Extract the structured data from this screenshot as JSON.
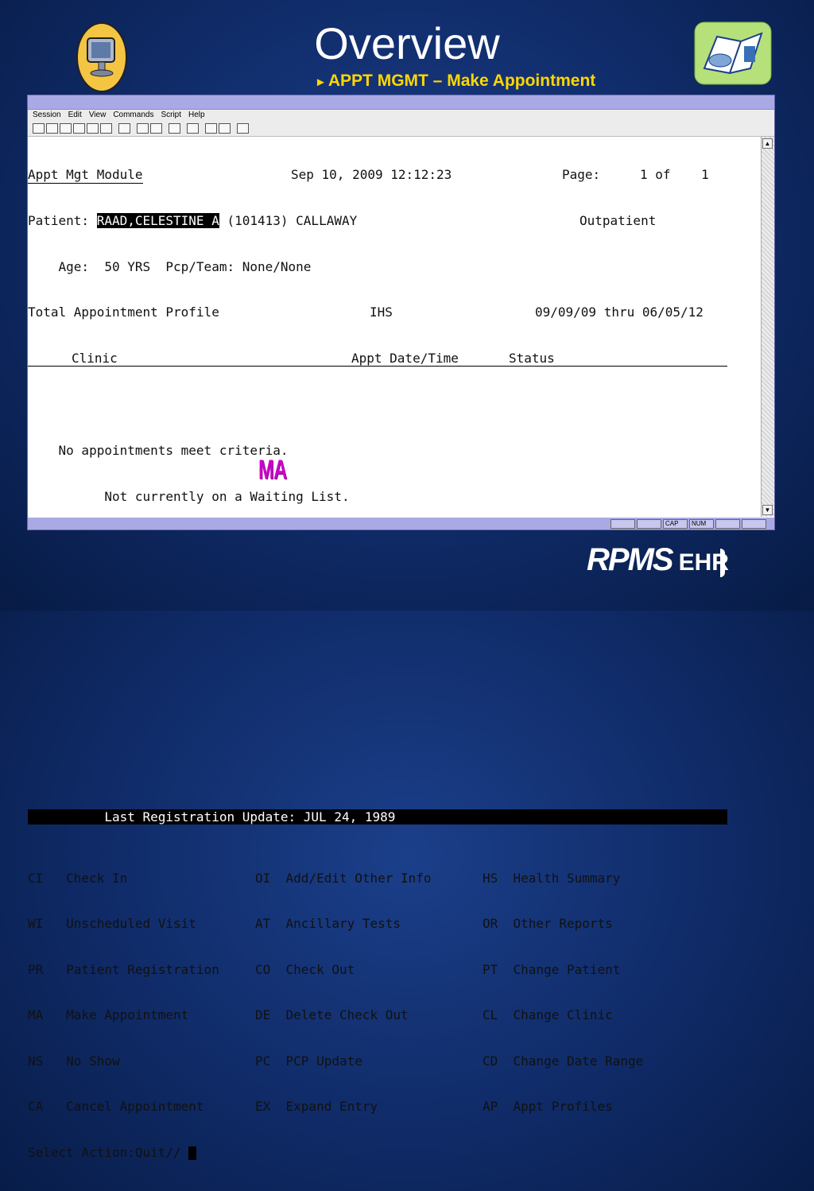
{
  "slide": {
    "title": "Overview",
    "subtitle": "APPT MGMT – Make Appointment",
    "subtitle_arrow": "►",
    "stamp": "MA",
    "logo_main": "RPMS",
    "logo_sub": "EHR",
    "icons": [
      "computer-monitor-icon",
      "open-book-icon"
    ]
  },
  "menu": [
    "Session",
    "Edit",
    "View",
    "Commands",
    "Script",
    "Help"
  ],
  "terminal": {
    "header_left": "Appt Mgt Module",
    "header_date": "Sep 10, 2009 12:12:23",
    "header_page_label": "Page:",
    "header_page": "1 of    1",
    "patient_label": "Patient:",
    "patient_name": "RAAD,CELESTINE A",
    "patient_rest": "(101413) CALLAWAY",
    "patient_type": "Outpatient",
    "age_line": "    Age:  50 YRS  Pcp/Team: None/None",
    "profile_line_left": "Total Appointment Profile",
    "profile_ihs": "IHS",
    "profile_range": "09/09/09 thru 06/05/12",
    "col_clinic": "Clinic",
    "col_appt": "Appt Date/Time",
    "col_status": "Status",
    "msg1": "    No appointments meet criteria.",
    "msg2": "          Not currently on a Waiting List.",
    "last_reg": "          Last Registration Update: JUL 24, 1989",
    "actions": [
      [
        "CI   Check In",
        "OI  Add/Edit Other Info",
        "HS  Health Summary"
      ],
      [
        "WI   Unscheduled Visit",
        "AT  Ancillary Tests",
        "OR  Other Reports"
      ],
      [
        "PR   Patient Registration",
        "CO  Check Out",
        "PT  Change Patient"
      ],
      [
        "MA   Make Appointment",
        "DE  Delete Check Out",
        "CL  Change Clinic"
      ],
      [
        "NS   No Show",
        "PC  PCP Update",
        "CD  Change Date Range"
      ],
      [
        "CA   Cancel Appointment",
        "EX  Expand Entry",
        "AP  Appt Profiles"
      ]
    ],
    "prompt": "Select Action:Quit// "
  },
  "status": [
    "",
    "",
    "CAP",
    "NUM",
    "",
    ""
  ]
}
